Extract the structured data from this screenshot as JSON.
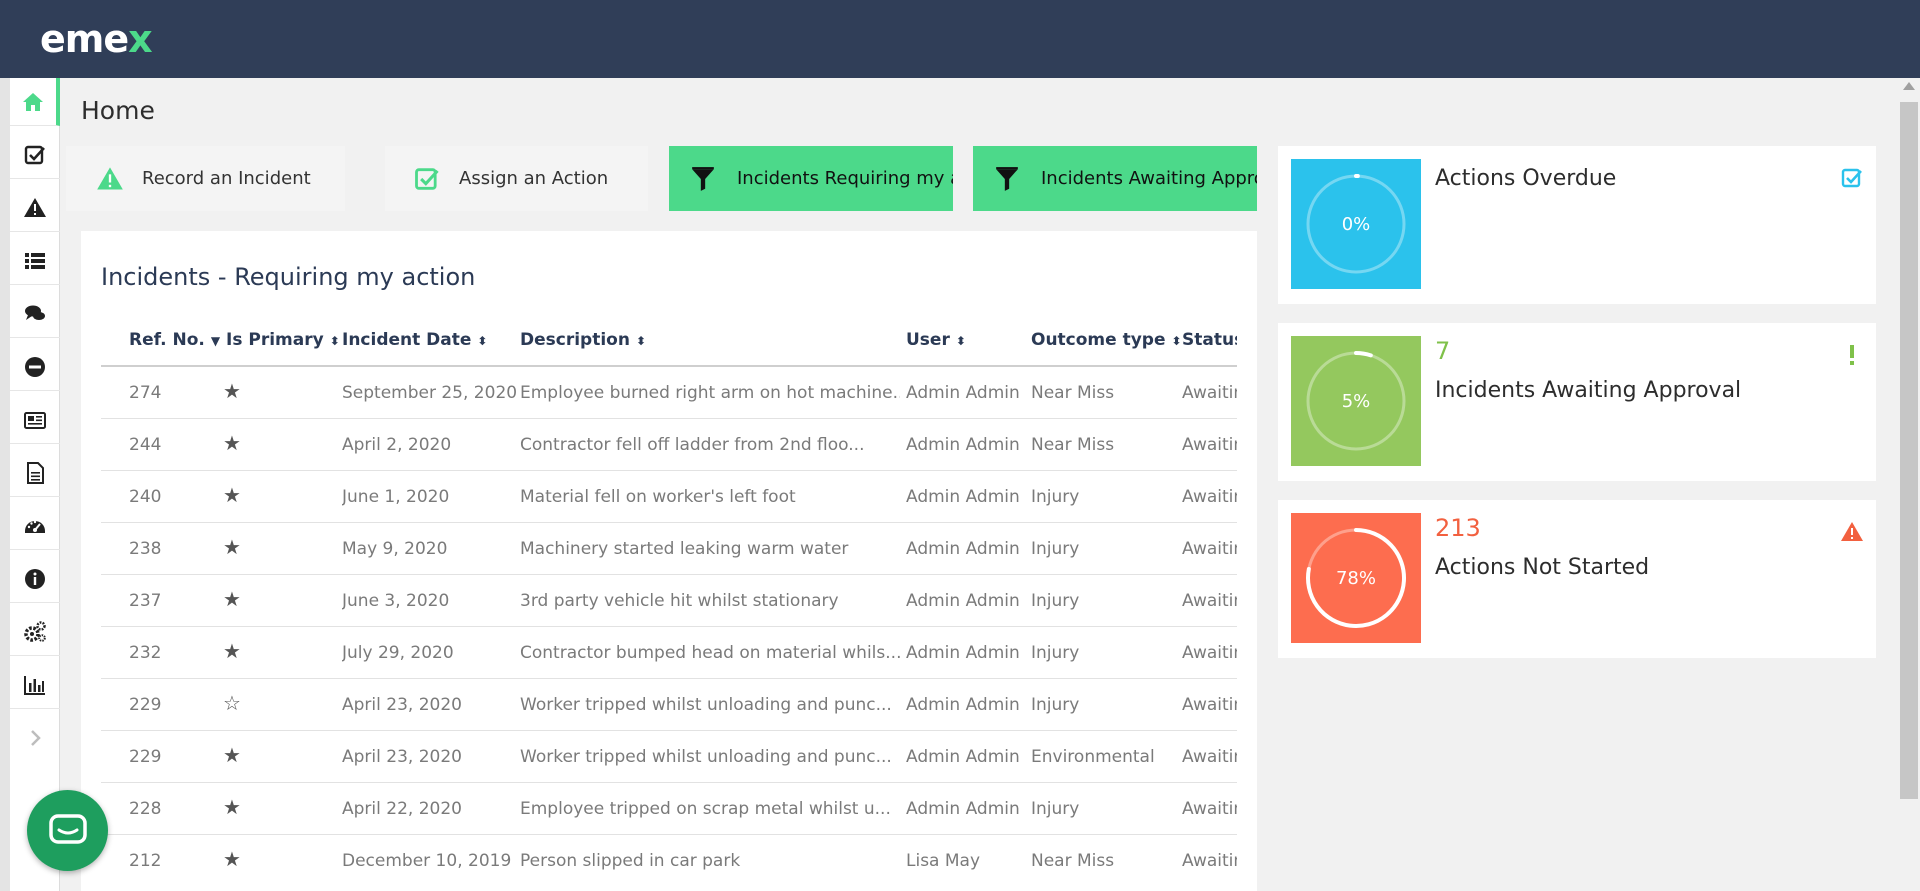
{
  "brand": {
    "logo_main": "eme",
    "logo_accent": "x"
  },
  "sidebar": {
    "items": [
      {
        "icon": "home-icon",
        "active": true
      },
      {
        "icon": "check-square-icon"
      },
      {
        "icon": "warning-icon"
      },
      {
        "icon": "list-icon"
      },
      {
        "icon": "chat-icon"
      },
      {
        "icon": "no-entry-icon"
      },
      {
        "icon": "newspaper-icon"
      },
      {
        "icon": "document-icon"
      },
      {
        "icon": "dashboard-icon"
      },
      {
        "icon": "info-icon"
      },
      {
        "icon": "settings-icon"
      },
      {
        "icon": "bar-chart-icon"
      },
      {
        "icon": "chevron-right-icon"
      }
    ]
  },
  "page": {
    "title": "Home"
  },
  "quick_actions": [
    {
      "label": "Record an Incident",
      "icon": "warning-icon",
      "style": "light"
    },
    {
      "label": "Assign an Action",
      "icon": "check-square-icon",
      "style": "light"
    },
    {
      "label": "Incidents Requiring my action",
      "icon": "filter-icon",
      "style": "green"
    },
    {
      "label": "Incidents Awaiting Approval",
      "icon": "filter-icon",
      "style": "green"
    }
  ],
  "incidents_table": {
    "title": "Incidents - Requiring my action",
    "columns": [
      "Ref. No.",
      "Is Primary",
      "Incident Date",
      "Description",
      "User",
      "Outcome type",
      "Status"
    ],
    "rows": [
      {
        "ref": "274",
        "primary": "★",
        "date": "September 25, 2020",
        "description": "Employee burned right arm on hot machine...",
        "user": "Admin Admin",
        "outcome": "Near Miss",
        "status": "Awaiting Approval"
      },
      {
        "ref": "244",
        "primary": "★",
        "date": "April 2, 2020",
        "description": "Contractor fell off ladder from 2nd floo...",
        "user": "Admin Admin",
        "outcome": "Near Miss",
        "status": "Awaiting Approval"
      },
      {
        "ref": "240",
        "primary": "★",
        "date": "June 1, 2020",
        "description": "Material fell on worker's left foot",
        "user": "Admin Admin",
        "outcome": "Injury",
        "status": "Awaiting Approval"
      },
      {
        "ref": "238",
        "primary": "★",
        "date": "May 9, 2020",
        "description": "Machinery started leaking warm water",
        "user": "Admin Admin",
        "outcome": "Injury",
        "status": "Awaiting Approval"
      },
      {
        "ref": "237",
        "primary": "★",
        "date": "June 3, 2020",
        "description": "3rd party vehicle hit whilst stationary",
        "user": "Admin Admin",
        "outcome": "Injury",
        "status": "Awaiting Approval"
      },
      {
        "ref": "232",
        "primary": "★",
        "date": "July 29, 2020",
        "description": "Contractor bumped head on material whils...",
        "user": "Admin Admin",
        "outcome": "Injury",
        "status": "Awaiting Approval"
      },
      {
        "ref": "229",
        "primary": "☆",
        "date": "April 23, 2020",
        "description": "Worker tripped whilst unloading and punc...",
        "user": "Admin Admin",
        "outcome": "Injury",
        "status": "Awaiting Approval"
      },
      {
        "ref": "229",
        "primary": "★",
        "date": "April 23, 2020",
        "description": "Worker tripped whilst unloading and punc...",
        "user": "Admin Admin",
        "outcome": "Environmental",
        "status": "Awaiting Approval"
      },
      {
        "ref": "228",
        "primary": "★",
        "date": "April 22, 2020",
        "description": "Employee tripped on scrap metal whilst u...",
        "user": "Admin Admin",
        "outcome": "Injury",
        "status": "Awaiting Approval"
      },
      {
        "ref": "212",
        "primary": "★",
        "date": "December 10, 2019",
        "description": "Person slipped in car park",
        "user": "Lisa May",
        "outcome": "Near Miss",
        "status": "Awaiting Approval"
      }
    ]
  },
  "kpi_cards": [
    {
      "label": "Actions Overdue",
      "count": "",
      "percent_label": "0%",
      "percent": 0,
      "color": "#2bc2ec",
      "count_color": "#2bc2ec",
      "corner_icon": "check-square-icon"
    },
    {
      "label": "Incidents Awaiting Approval",
      "count": "7",
      "percent_label": "5%",
      "percent": 5,
      "color": "#94c85e",
      "count_color": "#7fc14a",
      "corner_icon": "exclamation-icon"
    },
    {
      "label": "Actions Not Started",
      "count": "213",
      "percent_label": "78%",
      "percent": 78,
      "color": "#fd6d4f",
      "count_color": "#f2603f",
      "corner_icon": "warning-icon"
    }
  ],
  "colors": {
    "topbar": "#303e58",
    "accent_green": "#4cd98a",
    "chat_button": "#1e9e5e"
  },
  "chat_widget": {
    "icon": "chat-bubble-icon"
  }
}
